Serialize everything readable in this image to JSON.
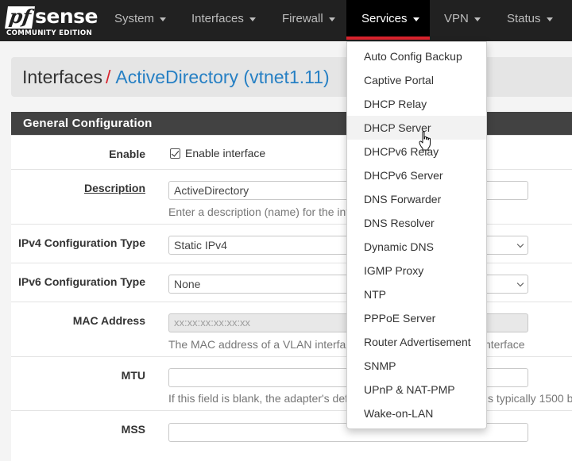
{
  "brand": {
    "logo_pf": "pf",
    "logo_sense": "sense",
    "edition": "COMMUNITY EDITION"
  },
  "nav": {
    "items": [
      {
        "label": "System"
      },
      {
        "label": "Interfaces"
      },
      {
        "label": "Firewall"
      },
      {
        "label": "Services"
      },
      {
        "label": "VPN"
      },
      {
        "label": "Status"
      }
    ],
    "active": "Services"
  },
  "breadcrumb": {
    "parent": "Interfaces",
    "separator": "/",
    "current": "ActiveDirectory (vtnet1.11)"
  },
  "panel": {
    "title": "General Configuration"
  },
  "form": {
    "enable": {
      "label": "Enable",
      "checkbox_label": "Enable interface",
      "checked": true
    },
    "description": {
      "label": "Description",
      "value": "ActiveDirectory",
      "help": "Enter a description (name) for the int"
    },
    "ipv4_type": {
      "label": "IPv4 Configuration Type",
      "value": "Static IPv4"
    },
    "ipv6_type": {
      "label": "IPv6 Configuration Type",
      "value": "None"
    },
    "mac": {
      "label": "MAC Address",
      "placeholder": "xx:xx:xx:xx:xx:xx",
      "help_left": "The MAC address of a VLAN interfac",
      "help_right": "nterface"
    },
    "mtu": {
      "label": "MTU",
      "value": "",
      "help_left": "If this field is blank, the adapter's def",
      "help_right": "s typically 1500 b"
    },
    "mss": {
      "label": "MSS",
      "value": ""
    }
  },
  "services_menu": {
    "items": [
      "Auto Config Backup",
      "Captive Portal",
      "DHCP Relay",
      "DHCP Server",
      "DHCPv6 Relay",
      "DHCPv6 Server",
      "DNS Forwarder",
      "DNS Resolver",
      "Dynamic DNS",
      "IGMP Proxy",
      "NTP",
      "PPPoE Server",
      "Router Advertisement",
      "SNMP",
      "UPnP & NAT-PMP",
      "Wake-on-LAN"
    ],
    "hovered": "DHCP Server"
  },
  "colors": {
    "navbar": "#212121",
    "accent_red": "#d9232d",
    "link_blue": "#2780c4",
    "panel_heading": "#424242"
  }
}
